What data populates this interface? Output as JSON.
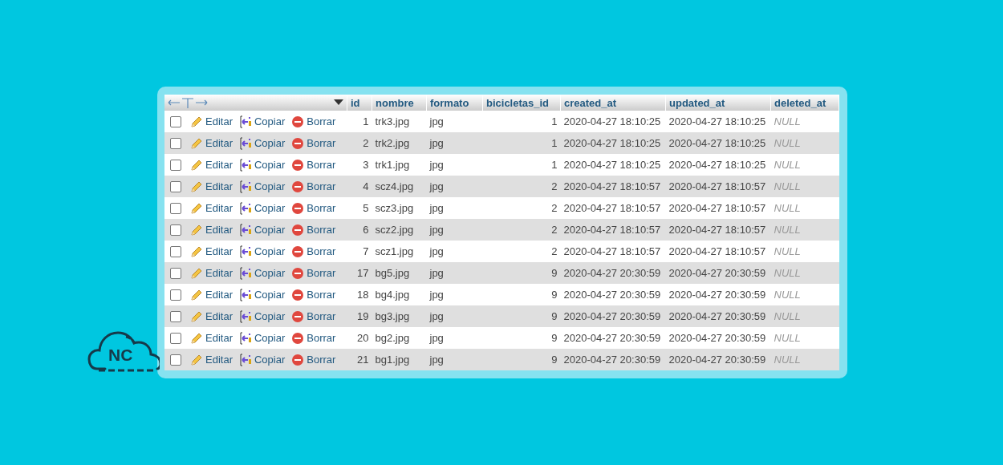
{
  "table": {
    "columns": [
      "id",
      "nombre",
      "formato",
      "bicicletas_id",
      "created_at",
      "updated_at",
      "deleted_at"
    ],
    "rows": [
      {
        "checked": false,
        "actions": [
          "Editar",
          "Copiar",
          "Borrar"
        ],
        "cells": [
          "1",
          "trk3.jpg",
          "jpg",
          "1",
          "2020-04-27 18:10:25",
          "2020-04-27 18:10:25",
          "NULL"
        ]
      },
      {
        "checked": false,
        "actions": [
          "Editar",
          "Copiar",
          "Borrar"
        ],
        "cells": [
          "2",
          "trk2.jpg",
          "jpg",
          "1",
          "2020-04-27 18:10:25",
          "2020-04-27 18:10:25",
          "NULL"
        ]
      },
      {
        "checked": false,
        "actions": [
          "Editar",
          "Copiar",
          "Borrar"
        ],
        "cells": [
          "3",
          "trk1.jpg",
          "jpg",
          "1",
          "2020-04-27 18:10:25",
          "2020-04-27 18:10:25",
          "NULL"
        ]
      },
      {
        "checked": false,
        "actions": [
          "Editar",
          "Copiar",
          "Borrar"
        ],
        "cells": [
          "4",
          "scz4.jpg",
          "jpg",
          "2",
          "2020-04-27 18:10:57",
          "2020-04-27 18:10:57",
          "NULL"
        ]
      },
      {
        "checked": false,
        "actions": [
          "Editar",
          "Copiar",
          "Borrar"
        ],
        "cells": [
          "5",
          "scz3.jpg",
          "jpg",
          "2",
          "2020-04-27 18:10:57",
          "2020-04-27 18:10:57",
          "NULL"
        ]
      },
      {
        "checked": false,
        "actions": [
          "Editar",
          "Copiar",
          "Borrar"
        ],
        "cells": [
          "6",
          "scz2.jpg",
          "jpg",
          "2",
          "2020-04-27 18:10:57",
          "2020-04-27 18:10:57",
          "NULL"
        ]
      },
      {
        "checked": false,
        "actions": [
          "Editar",
          "Copiar",
          "Borrar"
        ],
        "cells": [
          "7",
          "scz1.jpg",
          "jpg",
          "2",
          "2020-04-27 18:10:57",
          "2020-04-27 18:10:57",
          "NULL"
        ]
      },
      {
        "checked": false,
        "actions": [
          "Editar",
          "Copiar",
          "Borrar"
        ],
        "cells": [
          "17",
          "bg5.jpg",
          "jpg",
          "9",
          "2020-04-27 20:30:59",
          "2020-04-27 20:30:59",
          "NULL"
        ]
      },
      {
        "checked": false,
        "actions": [
          "Editar",
          "Copiar",
          "Borrar"
        ],
        "cells": [
          "18",
          "bg4.jpg",
          "jpg",
          "9",
          "2020-04-27 20:30:59",
          "2020-04-27 20:30:59",
          "NULL"
        ]
      },
      {
        "checked": false,
        "actions": [
          "Editar",
          "Copiar",
          "Borrar"
        ],
        "cells": [
          "19",
          "bg3.jpg",
          "jpg",
          "9",
          "2020-04-27 20:30:59",
          "2020-04-27 20:30:59",
          "NULL"
        ]
      },
      {
        "checked": false,
        "actions": [
          "Editar",
          "Copiar",
          "Borrar"
        ],
        "cells": [
          "20",
          "bg2.jpg",
          "jpg",
          "9",
          "2020-04-27 20:30:59",
          "2020-04-27 20:30:59",
          "NULL"
        ]
      },
      {
        "checked": false,
        "actions": [
          "Editar",
          "Copiar",
          "Borrar"
        ],
        "cells": [
          "21",
          "bg1.jpg",
          "jpg",
          "9",
          "2020-04-27 20:30:59",
          "2020-04-27 20:30:59",
          "NULL"
        ]
      }
    ]
  },
  "logo": {
    "text": "NC"
  }
}
